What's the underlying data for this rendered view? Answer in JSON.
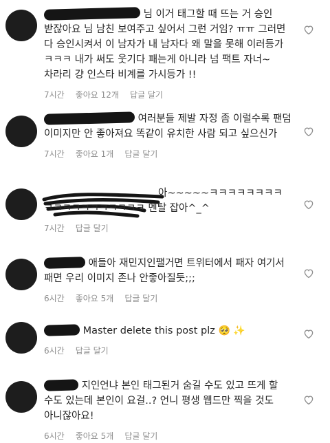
{
  "comments": [
    {
      "text": "님 이거 태그할 때 뜨는 거 승인 받잖아요 님 남친 보여주고 싶어서 그런 거임? ㅠㅠ 그러면 다 승인시켜서 이 남자가 내 남자다 왜 말을 못해 이러등가 ㅋㅋㅋ 내가 써도 웃기다 패는게 아니라 넘 팩트 자너~ 차라리 걍 인스타 비계를 가시등가 !!",
      "time": "7시간",
      "likes": "좋아요 12개",
      "reply": "답글 달기"
    },
    {
      "text": "여러분들 제발 자정 좀 이럴수록 팬덤 이미지만 안 좋아져요 똑같이 유치한 사람 되고 싶으신가",
      "time": "7시간",
      "likes": "좋아요 1개",
      "reply": "답글 달기"
    },
    {
      "text_a": "아~~~~~ㅋㅋㅋㅋㅋㅋㅋㅋ",
      "text_b": "ㅋㅋㅋㅋㅋㅋㅋㅋㅋㅋㅋ",
      "text_c": "멘탈 잡아^_^",
      "time": "7시간",
      "reply": "답글 달기"
    },
    {
      "text": "애들아 재민지인팰거면 트위터에서 패자 여기서 패면 우리 이미지 존나 안좋아질듯;;;",
      "time": "6시간",
      "likes": "좋아요 5개",
      "reply": "답글 달기"
    },
    {
      "text": "Master delete this post plz",
      "emoji": "🥺 ✨",
      "time": "6시간",
      "reply": "답글 달기"
    },
    {
      "text": "지인언냐 본인 태그된거 숨길 수도 있고 뜨게 할 수도 있는데 본인이 요걸..? 언니 평생 웹드만 찍을 것도 아니잖아요!",
      "time": "6시간",
      "likes": "좋아요 5개",
      "reply": "답글 달기"
    }
  ],
  "colors": {
    "text": "#262626",
    "meta": "#8e8e8e",
    "heart": "#8e8e8e",
    "redaction": "#151515"
  },
  "icons": {
    "like": "heart-outline-icon"
  }
}
